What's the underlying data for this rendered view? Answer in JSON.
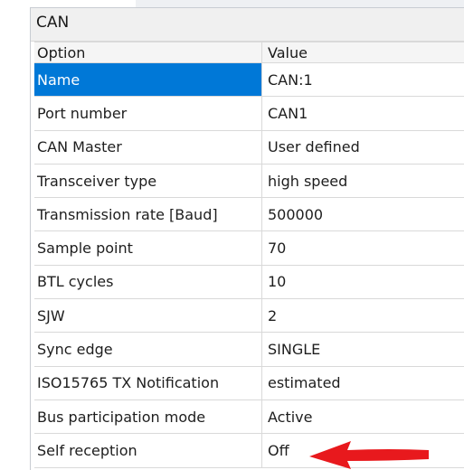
{
  "panel": {
    "title": "CAN",
    "columns": {
      "option": "Option",
      "value": "Value"
    },
    "rows": [
      {
        "option": "Name",
        "value": "CAN:1"
      },
      {
        "option": "Port number",
        "value": "CAN1"
      },
      {
        "option": "CAN Master",
        "value": "User defined"
      },
      {
        "option": "Transceiver type",
        "value": "high speed"
      },
      {
        "option": "Transmission rate [Baud]",
        "value": "500000"
      },
      {
        "option": "Sample point",
        "value": "70"
      },
      {
        "option": "BTL cycles",
        "value": "10"
      },
      {
        "option": "SJW",
        "value": "2"
      },
      {
        "option": "Sync edge",
        "value": "SINGLE"
      },
      {
        "option": "ISO15765 TX Notification",
        "value": "estimated"
      },
      {
        "option": "Bus participation mode",
        "value": "Active"
      },
      {
        "option": "Self reception",
        "value": "Off"
      }
    ]
  },
  "colors": {
    "selection": "#0078d7",
    "annotation_arrow": "#e8191d"
  },
  "annotation": {
    "icon": "red-arrow-icon",
    "points_to": "Self reception"
  }
}
